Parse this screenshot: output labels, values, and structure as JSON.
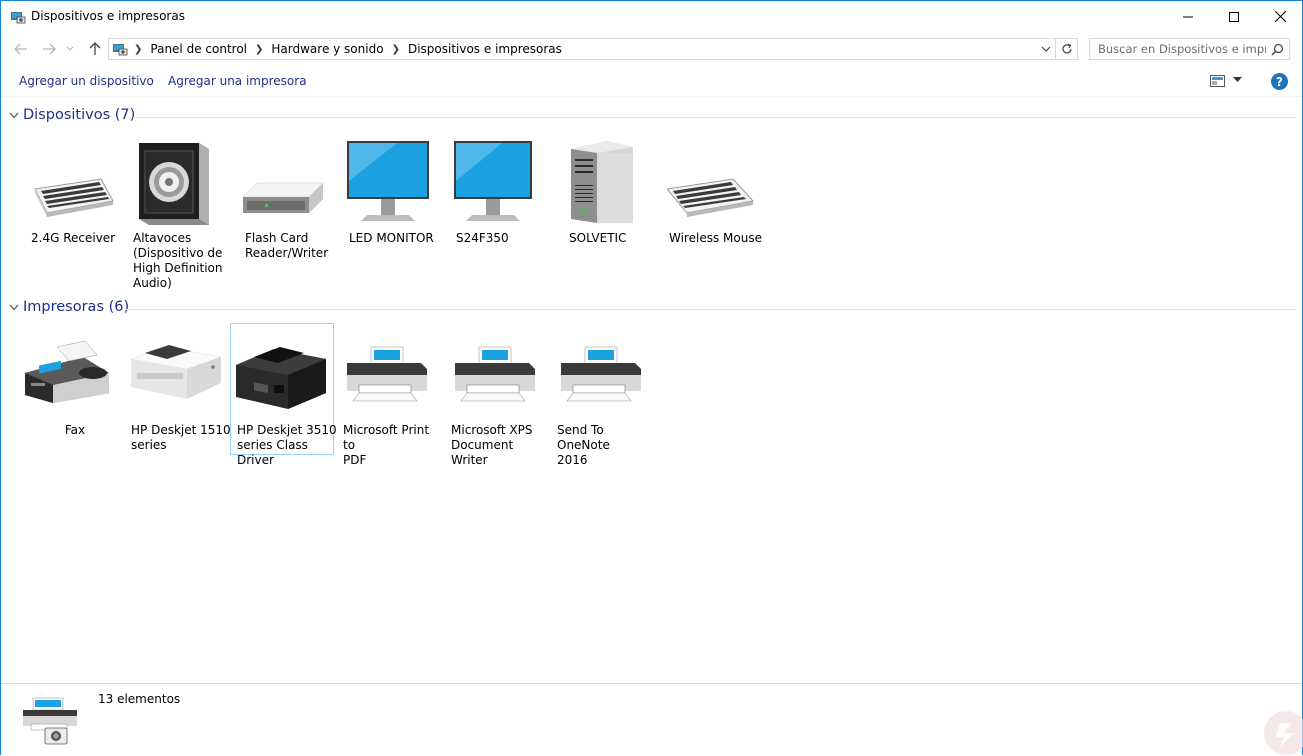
{
  "window": {
    "title": "Dispositivos e impresoras"
  },
  "breadcrumbs": [
    "Panel de control",
    "Hardware y sonido",
    "Dispositivos e impresoras"
  ],
  "search": {
    "placeholder": "Buscar en Dispositivos e impr..."
  },
  "commands": {
    "add_device": "Agregar un dispositivo",
    "add_printer": "Agregar una impresora",
    "help": "?"
  },
  "groups": {
    "devices": {
      "title": "Dispositivos (7)",
      "items": [
        {
          "label": "2.4G Receiver",
          "icon": "keyboard-icon"
        },
        {
          "label": "Altavoces\n(Dispositivo de\nHigh Definition\nAudio)",
          "icon": "speaker-icon"
        },
        {
          "label": "Flash Card\nReader/Writer",
          "icon": "card-reader-icon"
        },
        {
          "label": "LED MONITOR",
          "icon": "monitor-icon"
        },
        {
          "label": "S24F350",
          "icon": "monitor-icon"
        },
        {
          "label": "SOLVETIC",
          "icon": "computer-tower-icon"
        },
        {
          "label": "Wireless Mouse",
          "icon": "keyboard-icon"
        }
      ]
    },
    "printers": {
      "title": "Impresoras (6)",
      "items": [
        {
          "label": "Fax",
          "icon": "fax-icon"
        },
        {
          "label": "HP Deskjet 1510\nseries",
          "icon": "white-printer-icon"
        },
        {
          "label": "HP Deskjet 3510\nseries Class Driver",
          "icon": "black-printer-icon",
          "selected": true
        },
        {
          "label": "Microsoft Print to\nPDF",
          "icon": "printer-icon"
        },
        {
          "label": "Microsoft XPS\nDocument Writer",
          "icon": "printer-icon"
        },
        {
          "label": "Send To OneNote\n2016",
          "icon": "printer-icon"
        }
      ]
    }
  },
  "status": {
    "count_text": "13 elementos"
  },
  "colors": {
    "accent": "#1e3287",
    "link": "#1e3287",
    "window_border": "#1883d7",
    "monitor_screen": "#1ba1e2"
  }
}
